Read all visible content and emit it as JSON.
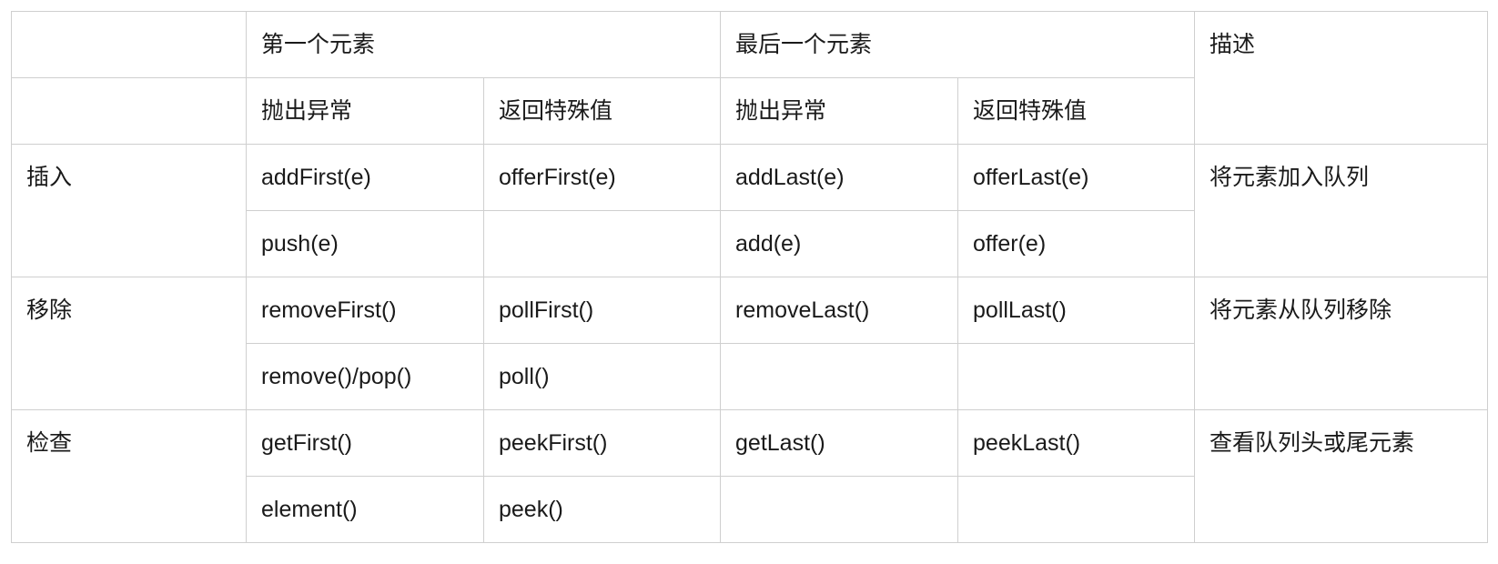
{
  "header": {
    "row1": {
      "corner": "",
      "first_element": "第一个元素",
      "last_element": "最后一个元素",
      "description": "描述"
    },
    "row2": {
      "corner": "",
      "first_throws": "抛出异常",
      "first_special": "返回特殊值",
      "last_throws": "抛出异常",
      "last_special": "返回特殊值"
    }
  },
  "rows": [
    {
      "operation": "插入",
      "description": "将元素加入队列",
      "lines": [
        {
          "first_throws": "addFirst(e)",
          "first_special": "offerFirst(e)",
          "last_throws": "addLast(e)",
          "last_special": "offerLast(e)"
        },
        {
          "first_throws": "push(e)",
          "first_special": "",
          "last_throws": "add(e)",
          "last_special": "offer(e)"
        }
      ]
    },
    {
      "operation": "移除",
      "description": "将元素从队列移除",
      "lines": [
        {
          "first_throws": "removeFirst()",
          "first_special": "pollFirst()",
          "last_throws": "removeLast()",
          "last_special": "pollLast()"
        },
        {
          "first_throws": "remove()/pop()",
          "first_special": "poll()",
          "last_throws": "",
          "last_special": ""
        }
      ]
    },
    {
      "operation": "检查",
      "description": "查看队列头或尾元素",
      "lines": [
        {
          "first_throws": "getFirst()",
          "first_special": "peekFirst()",
          "last_throws": "getLast()",
          "last_special": "peekLast()"
        },
        {
          "first_throws": "element()",
          "first_special": "peek()",
          "last_throws": "",
          "last_special": ""
        }
      ]
    }
  ]
}
